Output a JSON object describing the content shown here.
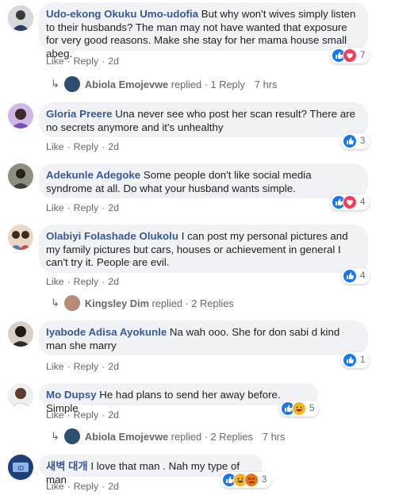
{
  "comments": [
    {
      "author": "Udo-ekong Okuku Umo-udofia",
      "text": "But why won't wives simply listen to their husbands? The man may not have wanted that exposure for very good reasons. Make she stay for her mama house small abeg.",
      "like": "Like",
      "reply": "Reply",
      "time": "2d",
      "reaction_count": "7",
      "reaction_icons": [
        "like-icon",
        "love-icon"
      ]
    },
    {
      "author": "Gloria Preere",
      "text": "Una never see who post her scan result? There are no secrets anymore and it's unhealthy",
      "like": "Like",
      "reply": "Reply",
      "time": "2d",
      "reaction_count": "3",
      "reaction_icons": [
        "like-icon"
      ]
    },
    {
      "author": "Adekunle Adegoke",
      "text": "Some people don't like social media syndrome at all. Do what your husband wants simple.",
      "like": "Like",
      "reply": "Reply",
      "time": "2d",
      "reaction_count": "4",
      "reaction_icons": [
        "like-icon",
        "love-icon"
      ]
    },
    {
      "author": "Olabiyi Folashade Olukolu",
      "text": "I can post my personal pictures and my family pictures but cars, houses or achievement in general I can't try it. People are evil.",
      "like": "Like",
      "reply": "Reply",
      "time": "2d",
      "reaction_count": "4",
      "reaction_icons": [
        "like-icon"
      ]
    },
    {
      "author": "Iyabode Adisa Ayokunle",
      "text": "Na wah ooo. She for don sabi d kind man she marry",
      "like": "Like",
      "reply": "Reply",
      "time": "2d",
      "reaction_count": "1",
      "reaction_icons": [
        "like-icon"
      ]
    },
    {
      "author": "Mo Dupsy",
      "text": "He had plans to send her away before. Simple",
      "like": "Like",
      "reply": "Reply",
      "time": "2d",
      "reaction_count": "5",
      "reaction_icons": [
        "like-icon",
        "haha-icon"
      ]
    },
    {
      "author": "새벽 대개",
      "text": "I love that man . Nah my type of man",
      "like": "Like",
      "reply": "Reply",
      "time": "2d",
      "reaction_count": "3",
      "reaction_icons": [
        "like-icon",
        "haha-icon",
        "angry-icon"
      ]
    }
  ],
  "replies": [
    {
      "name": "Abiola Emojevwe",
      "action": "replied",
      "dot": "·",
      "count": "1 Reply",
      "time": "7 hrs"
    },
    {
      "name": "Kingsley Dim",
      "action": "replied",
      "dot": "·",
      "count": "2 Replies",
      "time": ""
    },
    {
      "name": "Abiola Emojevwe",
      "action": "replied",
      "dot": "·",
      "count": "2 Replies",
      "time": "7 hrs"
    }
  ],
  "colors": {
    "author": "#385898",
    "bubble": "#f0f2f5",
    "meta": "#65676b",
    "like": "#1877f2",
    "love": "#f33e58",
    "haha": "#f7b125",
    "angry": "#e9710f"
  }
}
